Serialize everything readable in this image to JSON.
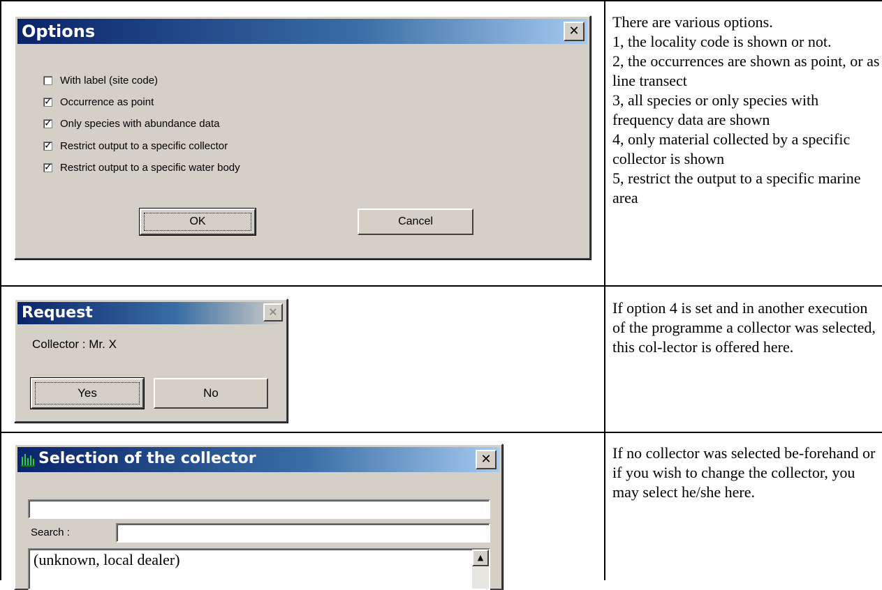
{
  "options_dialog": {
    "title": "Options",
    "close_glyph": "✕",
    "checkboxes": [
      {
        "label": "With label (site code)",
        "checked": false
      },
      {
        "label": "Occurrence as point",
        "checked": true
      },
      {
        "label": "Only species with abundance data",
        "checked": true
      },
      {
        "label": "Restrict output to a specific collector",
        "checked": true
      },
      {
        "label": "Restrict output to a specific water body",
        "checked": true
      }
    ],
    "ok_label": "OK",
    "cancel_label": "Cancel"
  },
  "options_description": "There are various options.\n1, the locality code is shown or not.\n2, the occurrences are shown as point, or as line transect\n3, all species or only species with frequency data are shown\n4, only material collected by a specific collector is shown\n5, restrict the output to a specific marine area",
  "request_dialog": {
    "title": "Request",
    "close_glyph": "✕",
    "message": "Collector : Mr. X",
    "yes_label": "Yes",
    "no_label": "No"
  },
  "request_description": "If option 4 is set and in another execution of the programme a collector was selected, this col-lector is offered here.",
  "selection_dialog": {
    "title": "Selection of the collector",
    "close_glyph": "✕",
    "top_field_value": "",
    "search_label": "Search :",
    "search_value": "",
    "list_items": [
      "(unknown, local dealer)"
    ],
    "scroll_up_glyph": "▲"
  },
  "selection_description": "If no collector was selected be-forehand or if you wish to change the collector, you may select he/she here.",
  "colors": {
    "title_gradient_start": "#0a246a",
    "title_gradient_end": "#a6caf0",
    "dialog_face": "#d4d0c8"
  }
}
